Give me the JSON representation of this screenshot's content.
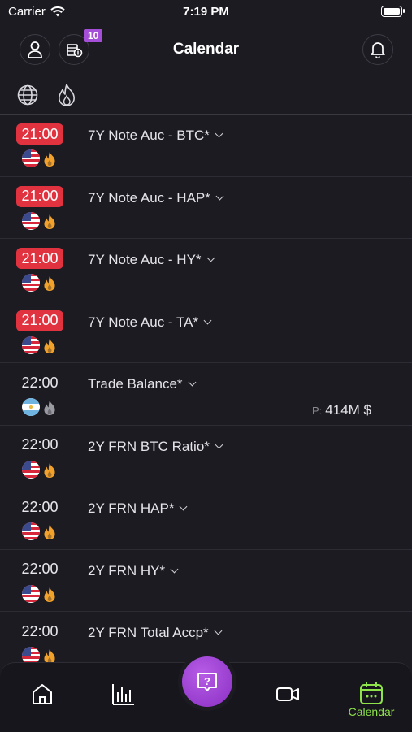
{
  "status_bar": {
    "carrier": "Carrier",
    "time": "7:19 PM"
  },
  "header": {
    "title": "Calendar",
    "badge_count": "10"
  },
  "filters": [
    {
      "icon": "globe-icon"
    },
    {
      "icon": "flame-icon"
    }
  ],
  "events": [
    {
      "time": "21:00",
      "time_style": "red",
      "country": "US",
      "impact": "high",
      "title": "7Y Note Auc - BTC*",
      "previous_label": "",
      "previous_value": ""
    },
    {
      "time": "21:00",
      "time_style": "red",
      "country": "US",
      "impact": "high",
      "title": "7Y Note Auc - HAP*",
      "previous_label": "",
      "previous_value": ""
    },
    {
      "time": "21:00",
      "time_style": "red",
      "country": "US",
      "impact": "high",
      "title": "7Y Note Auc - HY*",
      "previous_label": "",
      "previous_value": ""
    },
    {
      "time": "21:00",
      "time_style": "red",
      "country": "US",
      "impact": "high",
      "title": "7Y Note Auc - TA*",
      "previous_label": "",
      "previous_value": ""
    },
    {
      "time": "22:00",
      "time_style": "plain",
      "country": "AR",
      "impact": "low",
      "title": "Trade Balance*",
      "previous_label": "P:",
      "previous_value": "414M $"
    },
    {
      "time": "22:00",
      "time_style": "plain",
      "country": "US",
      "impact": "high",
      "title": "2Y FRN BTC Ratio*",
      "previous_label": "",
      "previous_value": ""
    },
    {
      "time": "22:00",
      "time_style": "plain",
      "country": "US",
      "impact": "high",
      "title": "2Y FRN HAP*",
      "previous_label": "",
      "previous_value": ""
    },
    {
      "time": "22:00",
      "time_style": "plain",
      "country": "US",
      "impact": "high",
      "title": "2Y FRN HY*",
      "previous_label": "",
      "previous_value": ""
    },
    {
      "time": "22:00",
      "time_style": "plain",
      "country": "US",
      "impact": "high",
      "title": "2Y FRN Total Accp*",
      "previous_label": "",
      "previous_value": ""
    }
  ],
  "tabbar": {
    "items": [
      {
        "icon": "home-icon",
        "label": ""
      },
      {
        "icon": "chart-icon",
        "label": ""
      },
      {
        "icon": "help-icon",
        "label": ""
      },
      {
        "icon": "video-icon",
        "label": ""
      },
      {
        "icon": "calendar-icon",
        "label": "Calendar",
        "active": true
      }
    ]
  },
  "colors": {
    "background": "#1c1b22",
    "accent_red": "#e0323f",
    "accent_purple": "#a54fd8",
    "active_tab": "#8ee34a",
    "flame_high": "#f2a12b",
    "flame_low": "#9a9aa2"
  }
}
